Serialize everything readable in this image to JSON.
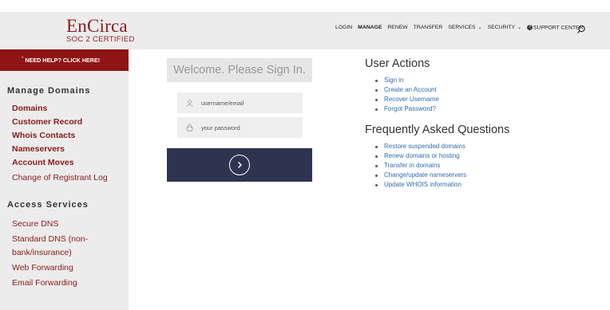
{
  "logo": {
    "main": "EnCirca",
    "sub": "SOC 2 CERTIFIED"
  },
  "nav": [
    {
      "label": "LOGIN",
      "chevron": false,
      "bold": false
    },
    {
      "label": "MANAGE",
      "chevron": false,
      "bold": true
    },
    {
      "label": "RENEW",
      "chevron": false,
      "bold": false
    },
    {
      "label": "TRANSFER",
      "chevron": false,
      "bold": false
    },
    {
      "label": "SERVICES",
      "chevron": true,
      "bold": false
    },
    {
      "label": "SECURITY",
      "chevron": true,
      "bold": false
    },
    {
      "label": "SUPPORT CENTER",
      "chevron": false,
      "bold": false,
      "icon": "help-circle-icon"
    }
  ],
  "sidebar": {
    "help_label": "NEED HELP? CLICK HERE!",
    "manage_heading": "Manage Domains",
    "manage_items": [
      {
        "label": "Domains",
        "bold": true
      },
      {
        "label": "Customer Record",
        "bold": true
      },
      {
        "label": "Whois Contacts",
        "bold": true
      },
      {
        "label": "Nameservers",
        "bold": true
      },
      {
        "label": "Account Moves",
        "bold": true
      },
      {
        "label": "Change of Registrant Log",
        "bold": false
      }
    ],
    "access_heading": "Access Services",
    "access_items": [
      {
        "label": "Secure DNS"
      },
      {
        "label": "Standard DNS (non-"
      },
      {
        "label": "bank/insurance)"
      },
      {
        "label": "Web Forwarding"
      },
      {
        "label": "Email Forwarding"
      }
    ]
  },
  "signin": {
    "welcome": "Welcome. Please Sign In.",
    "username_placeholder": "username/email",
    "password_placeholder": "your password"
  },
  "user_actions": {
    "title": "User Actions",
    "links": [
      "Sign in",
      "Create an Account",
      "Recover Username",
      "Forgot Password?"
    ]
  },
  "faq": {
    "title": "Frequently Asked Questions",
    "links": [
      "Restore suspended domains",
      "Renew domains or hosting",
      "Transfer in domains",
      "Change/update nameservers",
      "Update WHOIS information"
    ]
  },
  "colors": {
    "brand": "#8f1414",
    "panel": "#2e3450",
    "link": "#2f6db0"
  }
}
